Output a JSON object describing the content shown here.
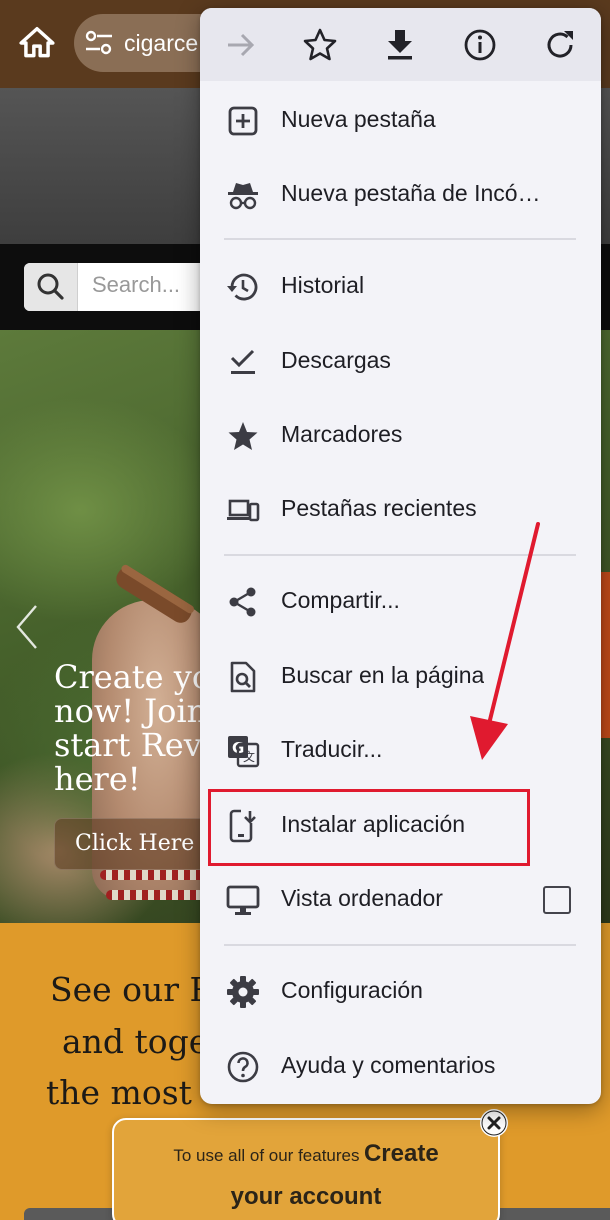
{
  "browser": {
    "url_text": "cigarce"
  },
  "page": {
    "search_placeholder": "Search...",
    "hero_lines": [
      "Create yo",
      "now! Join",
      "start Revi",
      "here!"
    ],
    "hero_button": "Click Here",
    "promo_lines": [
      "See our R",
      "and toge",
      "the most"
    ],
    "popup_text_small": "To use all of our features",
    "popup_text_bold_1": "Create",
    "popup_text_bold_2": "your account"
  },
  "menu": {
    "toolbar": [
      {
        "name": "forward-icon",
        "enabled": false
      },
      {
        "name": "star-icon",
        "enabled": true
      },
      {
        "name": "download-icon",
        "enabled": true
      },
      {
        "name": "info-icon",
        "enabled": true
      },
      {
        "name": "reload-icon",
        "enabled": true
      }
    ],
    "items": [
      {
        "label": "Nueva pestaña",
        "icon": "new-tab-icon"
      },
      {
        "label": "Nueva pestaña de Incó…",
        "icon": "incognito-icon"
      },
      {
        "label": "Historial",
        "icon": "history-icon"
      },
      {
        "label": "Descargas",
        "icon": "downloads-icon"
      },
      {
        "label": "Marcadores",
        "icon": "bookmarks-star-icon"
      },
      {
        "label": "Pestañas recientes",
        "icon": "devices-icon"
      },
      {
        "label": "Compartir...",
        "icon": "share-icon"
      },
      {
        "label": "Buscar en la página",
        "icon": "find-in-page-icon"
      },
      {
        "label": "Traducir...",
        "icon": "translate-icon"
      },
      {
        "label": "Instalar aplicación",
        "icon": "install-app-icon"
      },
      {
        "label": "Vista ordenador",
        "icon": "desktop-icon",
        "checkbox_checked": false
      },
      {
        "label": "Configuración",
        "icon": "settings-gear-icon"
      },
      {
        "label": "Ayuda y comentarios",
        "icon": "help-icon"
      }
    ]
  },
  "annotation": {
    "highlight_color": "#e01a2f"
  }
}
